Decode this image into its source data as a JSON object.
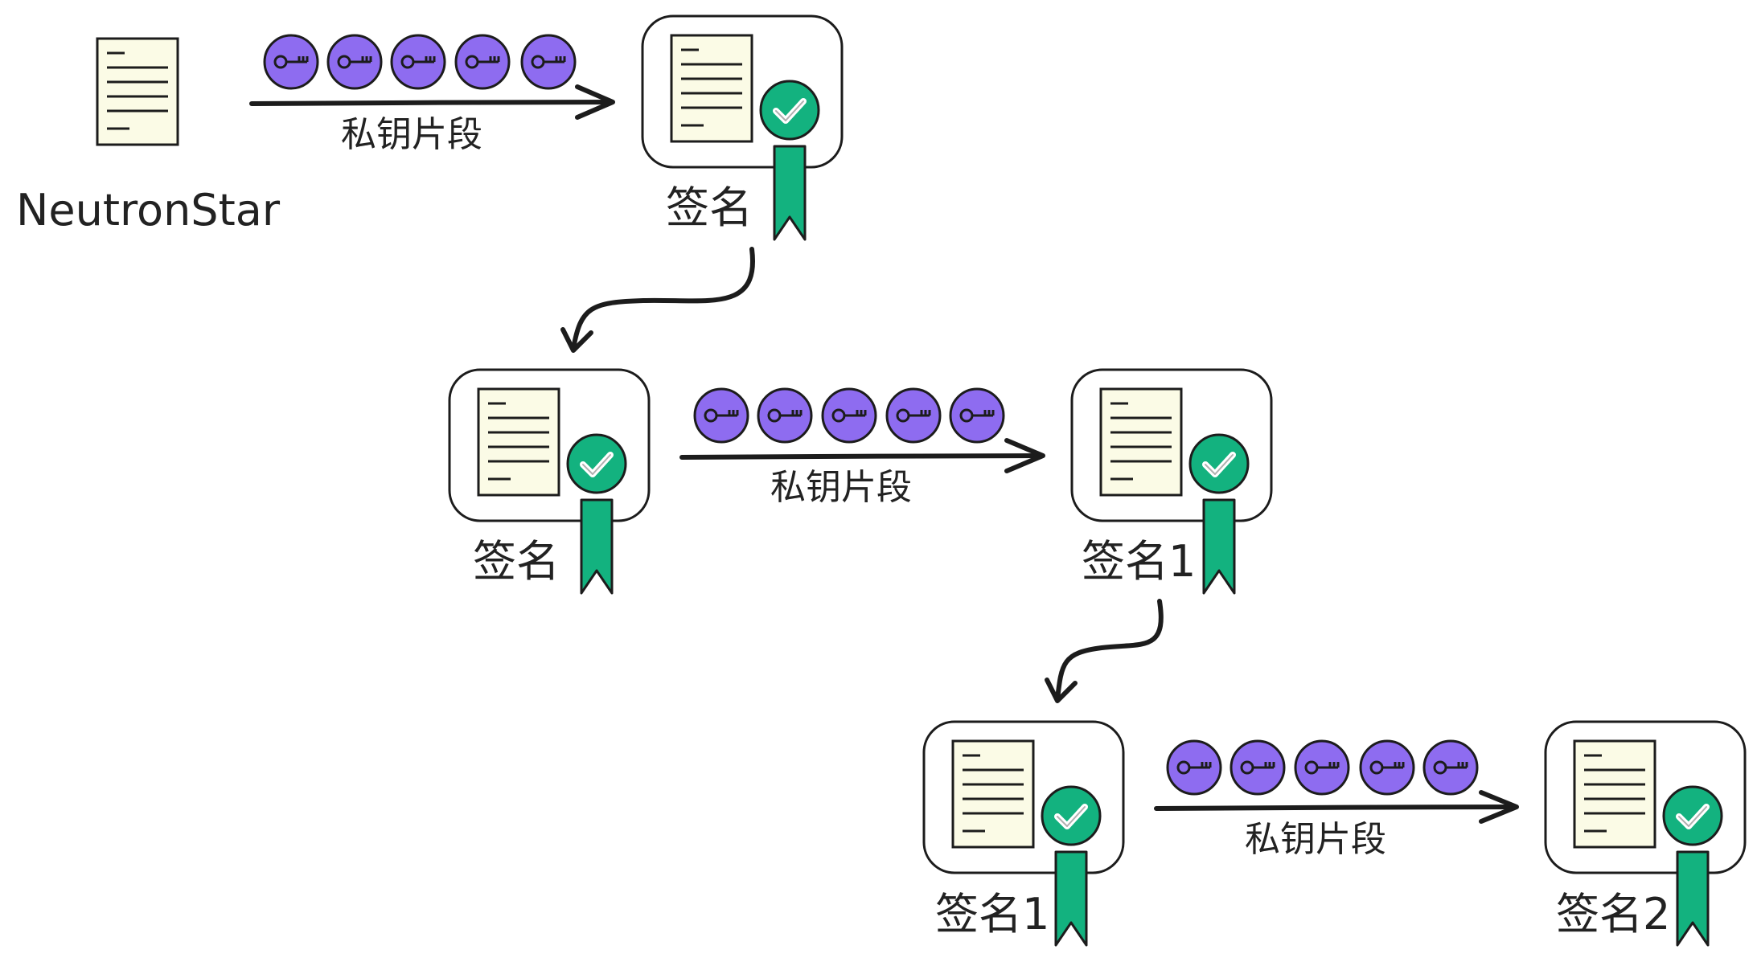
{
  "diagram": {
    "source": {
      "label": "NeutronStar",
      "icon": "document-icon"
    },
    "rows": [
      {
        "input_label": "",
        "edge_label": "私钥片段",
        "key_count": 5,
        "output_label": "签名"
      },
      {
        "input_label": "签名",
        "edge_label": "私钥片段",
        "key_count": 5,
        "output_label": "签名1"
      },
      {
        "input_label": "签名1",
        "edge_label": "私钥片段",
        "key_count": 5,
        "output_label": "签名2"
      }
    ],
    "connectors": [
      {
        "from": "签名",
        "to": "签名"
      },
      {
        "from": "签名1",
        "to": "签名1"
      }
    ],
    "icons": {
      "document": "document-icon",
      "key": "key-icon",
      "check_badge": "check-badge-icon",
      "ribbon": "ribbon-icon"
    },
    "colors": {
      "key_fill": "#8e6cf0",
      "badge_fill": "#13b27f",
      "paper_fill": "#fbfbe6",
      "stroke": "#1c1c1c"
    }
  }
}
